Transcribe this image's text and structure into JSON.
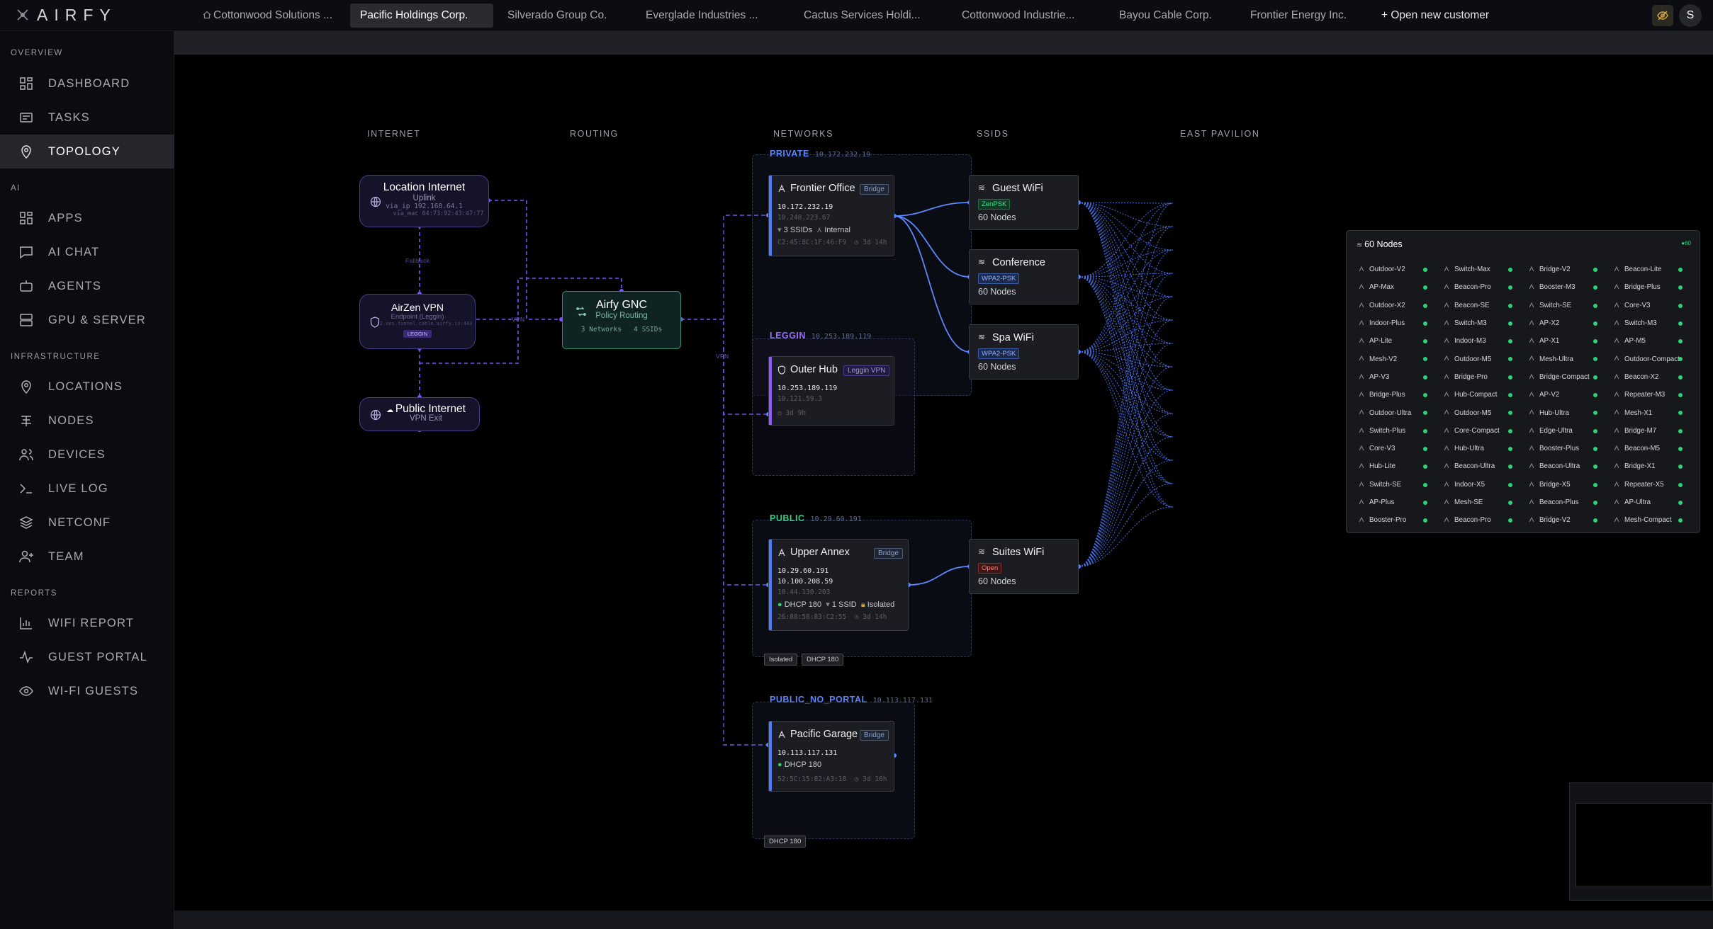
{
  "app": {
    "logo": "AIRFY"
  },
  "tabs": [
    {
      "label": "Cottonwood Solutions ...",
      "icon": "home-icon"
    },
    {
      "label": "Pacific Holdings Corp.",
      "active": true
    },
    {
      "label": "Silverado Group Co."
    },
    {
      "label": "Everglade Industries ..."
    },
    {
      "label": "Cactus Services Holdi..."
    },
    {
      "label": "Cottonwood Industrie..."
    },
    {
      "label": "Bayou Cable Corp."
    },
    {
      "label": "Frontier Energy Inc."
    },
    {
      "label": "+ Open new customer"
    }
  ],
  "user": {
    "initial": "S"
  },
  "sidebar": {
    "sections": [
      "OVERVIEW",
      "AI",
      "INFRASTRUCTURE",
      "REPORTS"
    ],
    "items": [
      {
        "label": "DASHBOARD",
        "icon": "grid-icon"
      },
      {
        "label": "TASKS",
        "icon": "tasks-icon"
      },
      {
        "label": "TOPOLOGY",
        "icon": "location-pin-icon",
        "active": true
      },
      {
        "label": "APPS",
        "icon": "grid-icon"
      },
      {
        "label": "AI CHAT",
        "icon": "chat-icon"
      },
      {
        "label": "AGENTS",
        "icon": "robot-icon"
      },
      {
        "label": "GPU & SERVER",
        "icon": "server-icon"
      },
      {
        "label": "LOCATIONS",
        "icon": "location-pin-icon"
      },
      {
        "label": "NODES",
        "icon": "nodes-icon"
      },
      {
        "label": "DEVICES",
        "icon": "users-icon"
      },
      {
        "label": "LIVE LOG",
        "icon": "terminal-icon"
      },
      {
        "label": "NETCONF",
        "icon": "layers-icon"
      },
      {
        "label": "TEAM",
        "icon": "add-user-icon"
      },
      {
        "label": "WIFI REPORT",
        "icon": "bar-chart-icon"
      },
      {
        "label": "GUEST PORTAL",
        "icon": "activity-icon"
      },
      {
        "label": "WI-FI GUESTS",
        "icon": "eye-icon"
      }
    ]
  },
  "columns": {
    "internet": "INTERNET",
    "routing": "ROUTING",
    "networks": "NETWORKS",
    "ssids": "SSIDS",
    "area": "EAST PAVILION"
  },
  "internet": {
    "location": {
      "title": "Location Internet",
      "sub": "Uplink",
      "via_ip": "via_ip 192.168.64.1",
      "via_mac": "via_mac 04:73:92:43:47:77"
    },
    "link_label": "Fallback",
    "vpn": {
      "title": "AirZen VPN",
      "sub": "Endpoint (Leggin)",
      "host": "l2.aos.tunnel.cable.airfy.io:443",
      "tag": "LEGGIN"
    },
    "public": {
      "title": "Public Internet",
      "sub": "VPN Exit"
    }
  },
  "routing": {
    "title": "Airfy GNC",
    "sub": "Policy Routing",
    "networks": "3 Networks",
    "ssids": "4 SSIDs",
    "vpn_label": "VPN",
    "vpn_label2": "VPN"
  },
  "groups": {
    "private": {
      "name": "PRIVATE",
      "subnet": "10.172.232.19",
      "color": "#4f7cff"
    },
    "leggin": {
      "name": "LEGGIN",
      "subnet": "10.253.189.119",
      "color": "#9b6dff"
    },
    "public": {
      "name": "PUBLIC",
      "subnet": "10.29.60.191",
      "color": "#2ecf86"
    },
    "noportal": {
      "name": "PUBLIC_NO_PORTAL",
      "subnet": "10.113.117.131",
      "color": "#4f7cff"
    }
  },
  "networks": {
    "frontier": {
      "title": "Frontier Office",
      "badge": "Bridge",
      "ip1": "10.172.232.19",
      "ip2": "10.240.223.67",
      "ssids": "3 SSIDs",
      "mode": "Internal",
      "mac": "C2:45:8C:1F:46:F9",
      "uptime": "3d 14h"
    },
    "outer": {
      "title": "Outer Hub",
      "badge": "Leggin VPN",
      "ip1": "10.253.189.119",
      "ip2": "10.121.59.3",
      "uptime": "3d 9h"
    },
    "upper": {
      "title": "Upper Annex",
      "badge": "Bridge",
      "ip1": "10.29.60.191",
      "ip2": "10.100.208.59",
      "ip3": "10.44.130.203",
      "dhcp": "DHCP 180",
      "ssids": "1 SSID",
      "mode": "Isolated",
      "mac": "26:88:58:83:C2:55",
      "uptime": "3d 14h"
    },
    "garage": {
      "title": "Pacific Garage",
      "badge": "Bridge",
      "ip1": "10.113.117.131",
      "dhcp": "DHCP 180",
      "mac": "52:5C:15:82:A3:18",
      "uptime": "3d 16h"
    }
  },
  "tags": {
    "isolated": "Isolated",
    "dhcp_public": "DHCP 180",
    "dhcp_noportal": "DHCP 180"
  },
  "ssids": {
    "guest": {
      "title": "Guest WiFi",
      "security": "ZenPSK",
      "count": "60 Nodes"
    },
    "conference": {
      "title": "Conference",
      "security": "WPA2-PSK",
      "count": "60 Nodes"
    },
    "spa": {
      "title": "Spa WiFi",
      "security": "WPA2-PSK",
      "count": "60 Nodes"
    },
    "suites": {
      "title": "Suites WiFi",
      "security": "Open",
      "count": "60 Nodes"
    }
  },
  "nodes_panel": {
    "title": "60 Nodes",
    "online": "60",
    "nodes": [
      "Outdoor-V2",
      "Switch-Max",
      "Bridge-V2",
      "Beacon-Lite",
      "AP-Max",
      "Beacon-Pro",
      "Booster-M3",
      "Bridge-Plus",
      "Outdoor-X2",
      "Beacon-SE",
      "Switch-SE",
      "Core-V3",
      "Indoor-Plus",
      "Switch-M3",
      "AP-X2",
      "Switch-M3",
      "AP-Lite",
      "Indoor-M3",
      "AP-X1",
      "AP-M5",
      "Mesh-V2",
      "Outdoor-M5",
      "Mesh-Ultra",
      "Outdoor-Compact",
      "AP-V3",
      "Bridge-Pro",
      "Bridge-Compact",
      "Beacon-X2",
      "Bridge-Plus",
      "Hub-Compact",
      "AP-V2",
      "Repeater-M3",
      "Outdoor-Ultra",
      "Outdoor-M5",
      "Hub-Ultra",
      "Mesh-X1",
      "Switch-Plus",
      "Core-Compact",
      "Edge-Ultra",
      "Bridge-M7",
      "Core-V3",
      "Hub-Ultra",
      "Booster-Plus",
      "Beacon-M5",
      "Hub-Lite",
      "Beacon-Ultra",
      "Beacon-Ultra",
      "Bridge-X1",
      "Switch-SE",
      "Indoor-X5",
      "Bridge-X5",
      "Repeater-X5",
      "AP-Plus",
      "Mesh-SE",
      "Beacon-Plus",
      "AP-Ultra",
      "Booster-Pro",
      "Beacon-Pro",
      "Bridge-V2",
      "Mesh-Compact"
    ]
  },
  "colors": {
    "accent": "#4f7cff",
    "vpn": "#8f6bff",
    "online": "#2ad37a",
    "routing": "#35c08e"
  }
}
